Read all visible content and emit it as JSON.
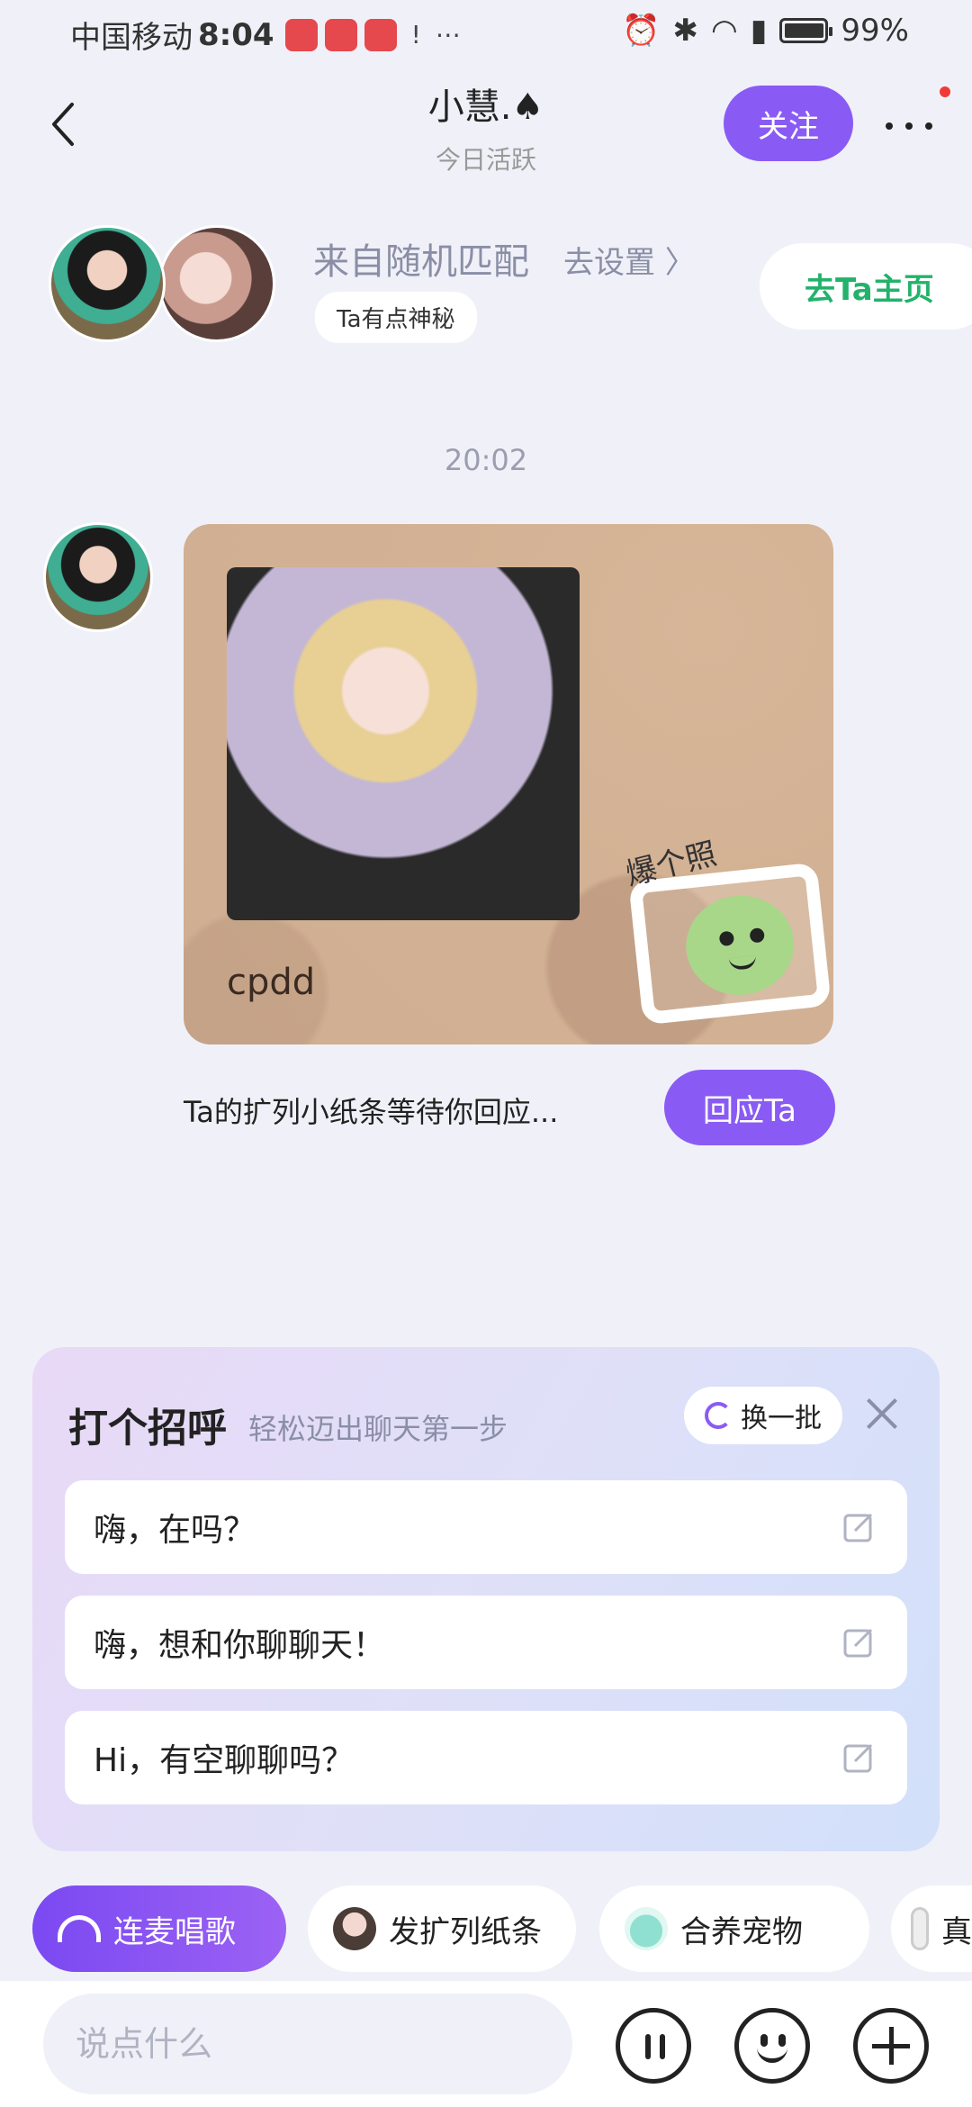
{
  "status_bar": {
    "carrier": "中国移动",
    "time": "8:04",
    "battery": "99%"
  },
  "header": {
    "name": "小慧.♠",
    "activity": "今日活跃",
    "follow_label": "关注"
  },
  "match": {
    "source": "来自随机匹配",
    "setting_link": "去设置 〉",
    "tag": "Ta有点神秘",
    "home_label": "去Ta主页"
  },
  "chat": {
    "timestamp": "20:02",
    "card_text": "cpdd",
    "sticker_text": "爆个照",
    "hint": "Ta的扩列小纸条等待你回应...",
    "respond_label": "回应Ta"
  },
  "greeting": {
    "title": "打个招呼",
    "subtitle": "轻松迈出聊天第一步",
    "refresh_label": "换一批",
    "items": [
      "嗨，在吗？",
      "嗨，想和你聊聊天！",
      "Hi，有空聊聊吗？"
    ]
  },
  "quick_actions": [
    "连麦唱歌",
    "发扩列纸条",
    "合养宠物",
    "真"
  ],
  "input": {
    "placeholder": "说点什么"
  },
  "colors": {
    "accent": "#8a5bf4",
    "home_green": "#23b26b",
    "background": "#f0f1f8"
  }
}
